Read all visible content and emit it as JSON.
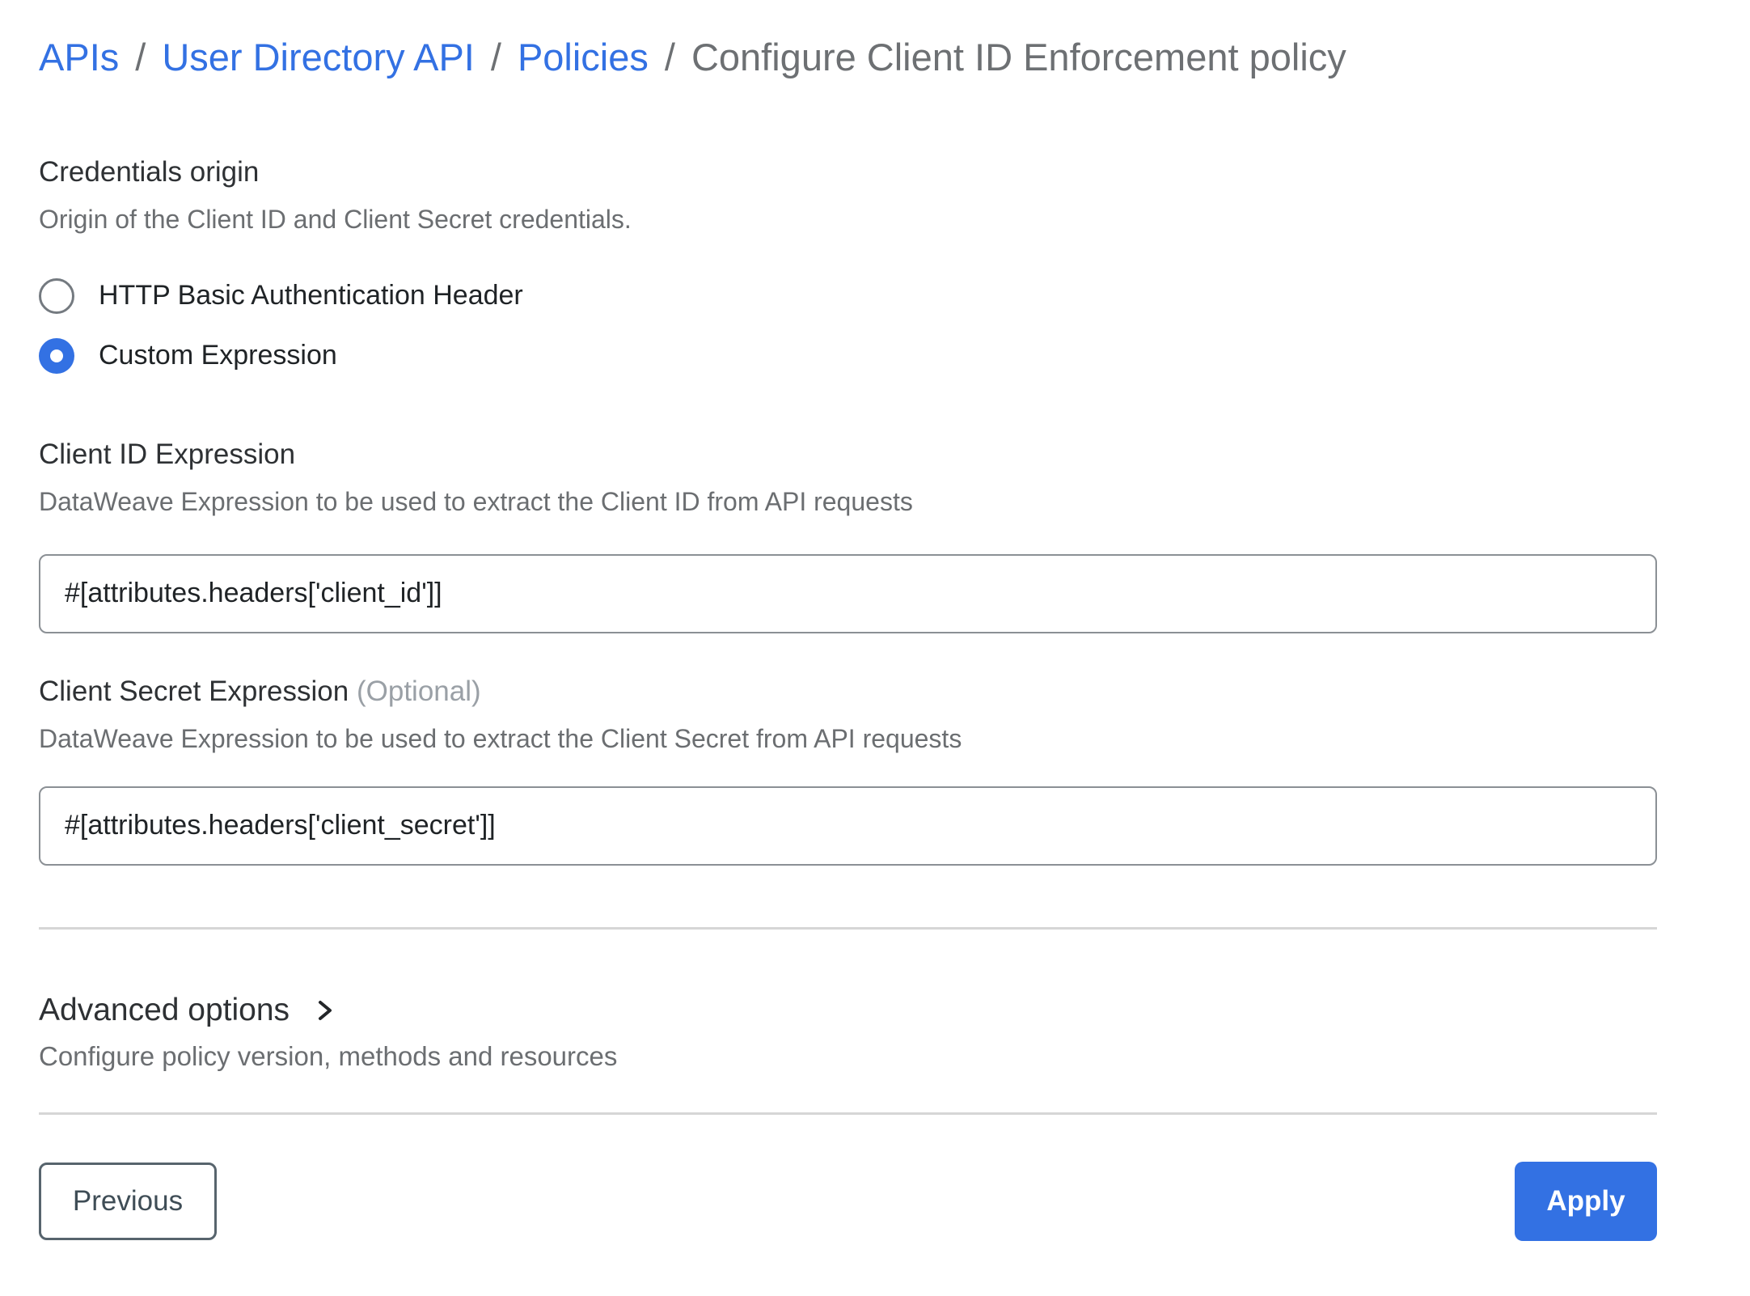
{
  "breadcrumb": {
    "separator": "/",
    "items": [
      {
        "label": "APIs",
        "type": "link"
      },
      {
        "label": "User Directory API",
        "type": "link"
      },
      {
        "label": "Policies",
        "type": "link"
      },
      {
        "label": "Configure Client ID Enforcement policy",
        "type": "current"
      }
    ]
  },
  "credentials_origin": {
    "label": "Credentials origin",
    "description": "Origin of the Client ID and Client Secret credentials.",
    "options": [
      {
        "label": "HTTP Basic Authentication Header",
        "selected": false
      },
      {
        "label": "Custom Expression",
        "selected": true
      }
    ]
  },
  "client_id": {
    "label": "Client ID Expression",
    "description": "DataWeave Expression to be used to extract the Client ID from API requests",
    "value": "#[attributes.headers['client_id']]"
  },
  "client_secret": {
    "label": "Client Secret Expression",
    "optional_suffix": "(Optional)",
    "description": "DataWeave Expression to be used to extract the Client Secret from API requests",
    "value": "#[attributes.headers['client_secret']]"
  },
  "advanced": {
    "label": "Advanced options",
    "description": "Configure policy version, methods and resources",
    "chevron_icon": "chevron-right"
  },
  "footer": {
    "previous_label": "Previous",
    "apply_label": "Apply"
  },
  "colors": {
    "link_blue": "#3371e3",
    "accent_blue": "#3371e3",
    "heading_text": "#2e3134",
    "muted_text": "#6b6e71",
    "divider": "#d6d6d6"
  }
}
